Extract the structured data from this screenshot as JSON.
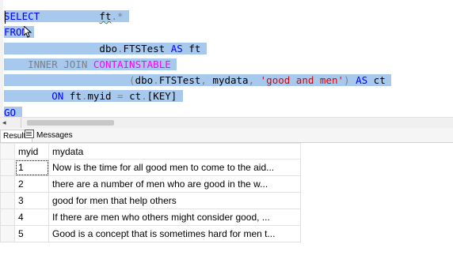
{
  "editor": {
    "lines": [
      [
        {
          "t": "SELECT",
          "c": "kw"
        },
        {
          "t": "          ",
          "c": "id"
        },
        {
          "t": "ft",
          "c": "id"
        },
        {
          "t": ".",
          "c": "gray"
        },
        {
          "t": "*",
          "c": "gray"
        }
      ],
      [
        {
          "t": "FROM",
          "c": "kw"
        }
      ],
      [
        {
          "t": "                ",
          "c": "id"
        },
        {
          "t": "dbo",
          "c": "id"
        },
        {
          "t": ".",
          "c": "gray"
        },
        {
          "t": "FTSTest",
          "c": "id"
        },
        {
          "t": " ",
          "c": "id"
        },
        {
          "t": "AS",
          "c": "kw"
        },
        {
          "t": " ft",
          "c": "id"
        }
      ],
      [
        {
          "t": "    ",
          "c": "id"
        },
        {
          "t": "INNER JOIN",
          "c": "gray"
        },
        {
          "t": " ",
          "c": "id"
        },
        {
          "t": "CONTAINSTABLE",
          "c": "fn"
        }
      ],
      [
        {
          "t": "                     ",
          "c": "id"
        },
        {
          "t": "(",
          "c": "gray"
        },
        {
          "t": "dbo",
          "c": "id"
        },
        {
          "t": ".",
          "c": "gray"
        },
        {
          "t": "FTSTest",
          "c": "id"
        },
        {
          "t": ",",
          "c": "gray"
        },
        {
          "t": " mydata",
          "c": "id"
        },
        {
          "t": ",",
          "c": "gray"
        },
        {
          "t": " ",
          "c": "id"
        },
        {
          "t": "'good and men'",
          "c": "str"
        },
        {
          "t": ")",
          "c": "gray"
        },
        {
          "t": " ",
          "c": "id"
        },
        {
          "t": "AS",
          "c": "kw"
        },
        {
          "t": " ct",
          "c": "id"
        }
      ],
      [
        {
          "t": "        ",
          "c": "id"
        },
        {
          "t": "ON",
          "c": "kw"
        },
        {
          "t": " ft",
          "c": "id"
        },
        {
          "t": ".",
          "c": "gray"
        },
        {
          "t": "myid ",
          "c": "id"
        },
        {
          "t": "=",
          "c": "gray"
        },
        {
          "t": " ct",
          "c": "id"
        },
        {
          "t": ".",
          "c": "gray"
        },
        {
          "t": "[KEY]",
          "c": "id"
        }
      ],
      [
        {
          "t": "GO",
          "c": "kw"
        }
      ]
    ]
  },
  "tabs": {
    "results_label": "Results",
    "messages_label": "Messages"
  },
  "grid": {
    "columns": [
      "myid",
      "mydata"
    ],
    "rows": [
      {
        "myid": "1",
        "mydata": "Now is the time for all good men to come to the aid..."
      },
      {
        "myid": "2",
        "mydata": "there are a number of men who are good in the w..."
      },
      {
        "myid": "3",
        "mydata": "good for men that help others"
      },
      {
        "myid": "4",
        "mydata": "If there are men who others might consider good, ..."
      },
      {
        "myid": "5",
        "mydata": "Good is a concept that is sometimes hard for men t..."
      }
    ]
  },
  "colors": {
    "keyword": "#0000ff",
    "function": "#ff00ff",
    "string": "#e00000",
    "operator": "#808080",
    "selection": "#a8c9ee"
  }
}
